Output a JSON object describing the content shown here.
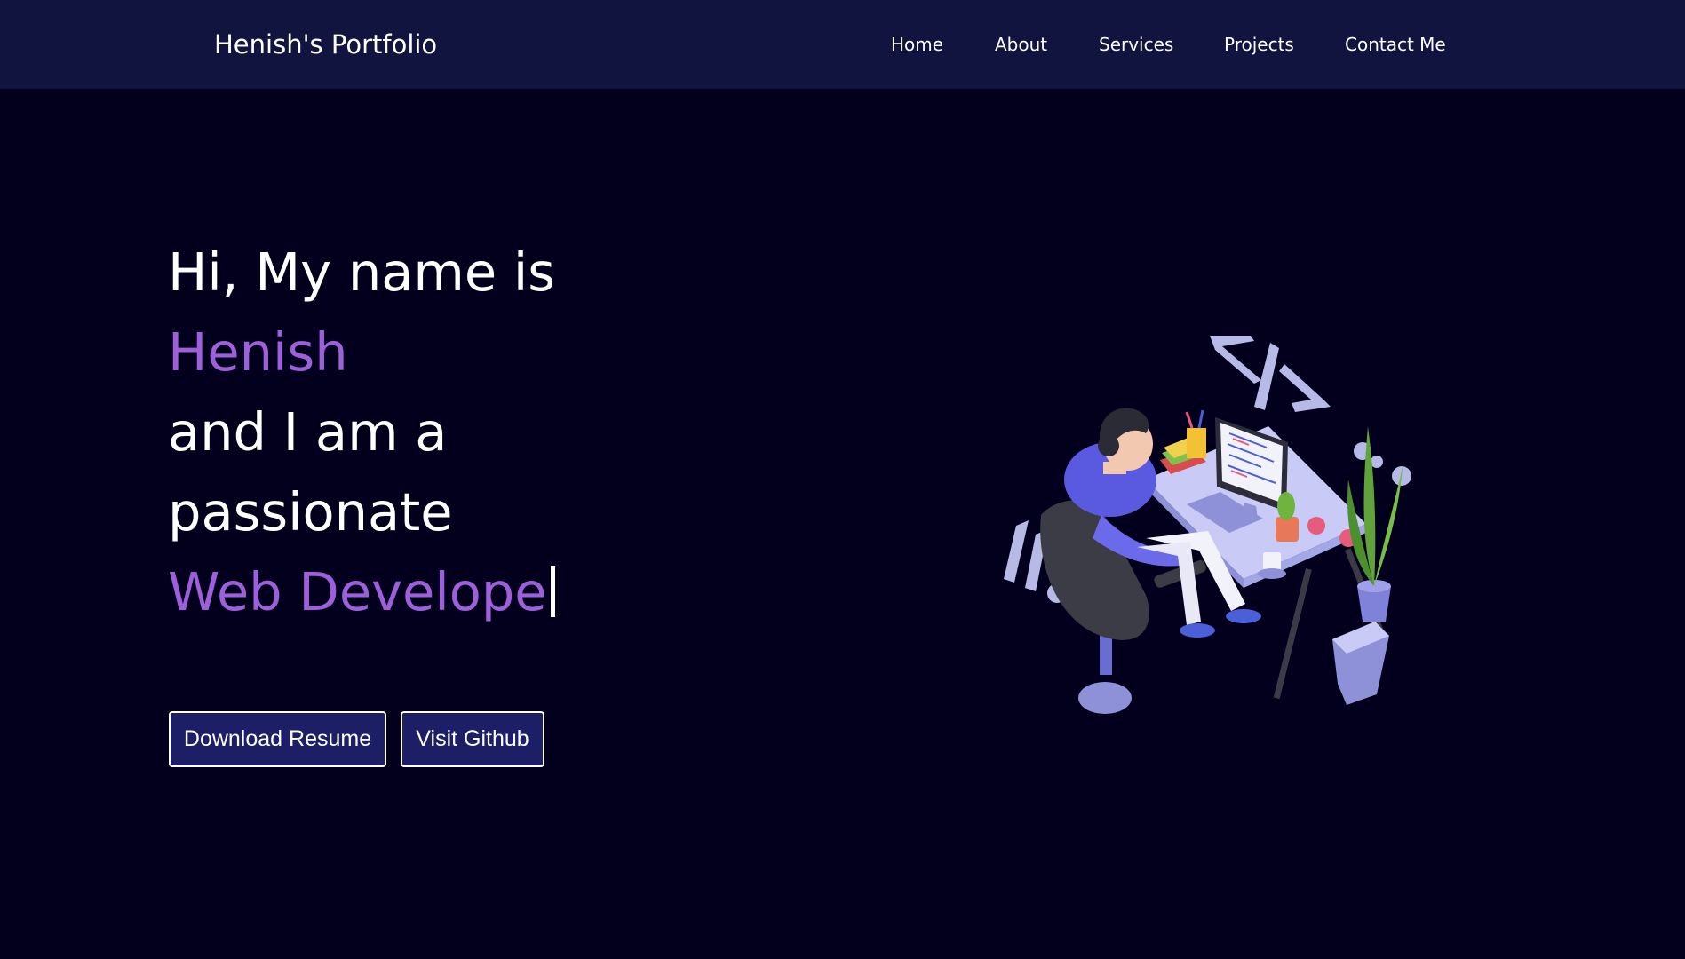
{
  "navbar": {
    "brand": "Henish's Portfolio",
    "links": [
      "Home",
      "About",
      "Services",
      "Projects",
      "Contact Me"
    ]
  },
  "hero": {
    "line1": "Hi, My name is",
    "name": "Henish",
    "line3": "and I am a",
    "line4": "passionate",
    "role_typed": "Web Develope"
  },
  "buttons": {
    "resume": "Download Resume",
    "github": "Visit Github"
  },
  "colors": {
    "page_background": "#02001c",
    "navbar_background": "#121440",
    "accent_purple": "#9e5fdb",
    "button_background": "#1d1f66",
    "text": "#ffffff"
  },
  "illustration": {
    "icon": "developer-at-desk-illustration",
    "monitor_symbol": "code-brackets-icon"
  }
}
